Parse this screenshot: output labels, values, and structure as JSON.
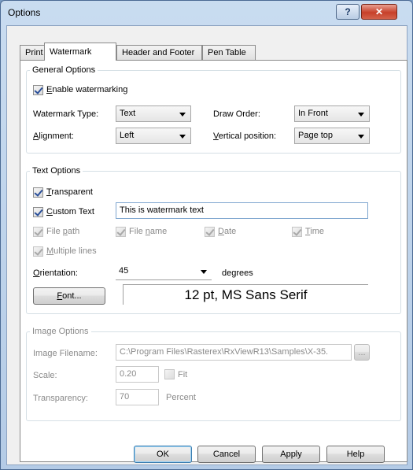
{
  "window": {
    "title": "Options",
    "help_label": "?",
    "close_label": "✕"
  },
  "tabs": [
    {
      "label": "Print"
    },
    {
      "label": "Watermark",
      "active": true
    },
    {
      "label": "Header and Footer"
    },
    {
      "label": "Pen Table"
    }
  ],
  "general": {
    "legend": "General Options",
    "enable": {
      "label_u": "E",
      "label_rest": "nable watermarking",
      "checked": true
    },
    "type_label": "Watermark Type:",
    "type_value": "Text",
    "order_label": "Draw Order:",
    "order_value": "In Front",
    "align_u": "A",
    "align_rest": "lignment:",
    "align_value": "Left",
    "vpos_u": "V",
    "vpos_rest": "ertical position:",
    "vpos_value": "Page top"
  },
  "text_opts": {
    "legend": "Text Options",
    "transparent_u": "T",
    "transparent_rest": "ransparent",
    "custom_u": "C",
    "custom_rest": "ustom Text",
    "custom_value": "This is watermark text",
    "filepath_pre": "File ",
    "filepath_u": "p",
    "filepath_rest": "ath",
    "filename_pre": "File ",
    "filename_u": "n",
    "filename_rest": "ame",
    "date_u": "D",
    "date_rest": "ate",
    "time_u": "T",
    "time_rest": "ime",
    "multi_u": "M",
    "multi_rest": "ultiple lines",
    "orient_u": "O",
    "orient_rest": "rientation:",
    "orient_value": "45",
    "degrees": "degrees",
    "font_u": "F",
    "font_rest": "ont...",
    "font_preview": "12 pt, MS Sans Serif"
  },
  "image_opts": {
    "legend": "Image Options",
    "filename_label": "Image Filename:",
    "filename_value": "C:\\Program Files\\Rasterex\\RxViewR13\\Samples\\X-35.",
    "browse_label": "...",
    "scale_label": "Scale:",
    "scale_value": "0.20",
    "fit_label": "Fit",
    "transparency_label": "Transparency:",
    "transparency_value": "70",
    "percent": "Percent"
  },
  "footer": {
    "ok": "OK",
    "cancel": "Cancel",
    "apply": "Apply",
    "help": "Help"
  }
}
